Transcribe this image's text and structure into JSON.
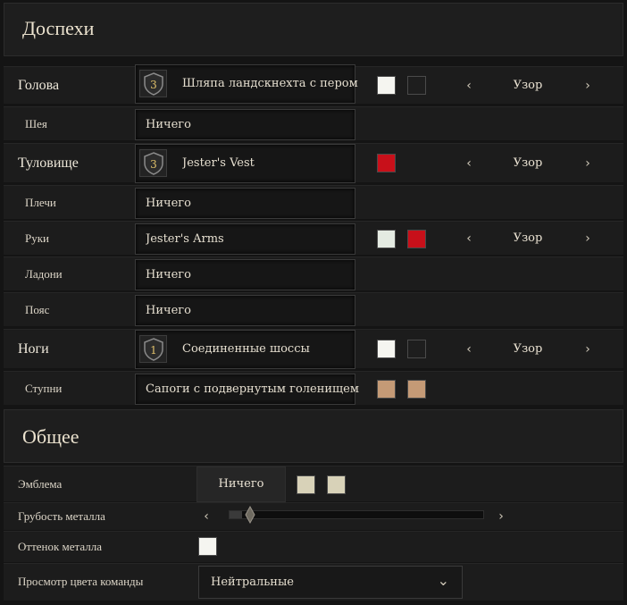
{
  "armor": {
    "title": "Доспехи",
    "rows": [
      {
        "label": "Голова",
        "item": "Шляпа ландскнехта с пером",
        "tier": "3",
        "pattern": "Узор",
        "colors": [
          "#f5f5f0",
          "#1e1e1e"
        ]
      },
      {
        "label": "Шея",
        "item": "Ничего"
      },
      {
        "label": "Туловище",
        "item": "Jester's Vest",
        "tier": "3",
        "pattern": "Узор",
        "colors": [
          "#c8101a"
        ]
      },
      {
        "label": "Плечи",
        "item": "Ничего"
      },
      {
        "label": "Руки",
        "item": "Jester's Arms",
        "pattern": "Узор",
        "colors": [
          "#e4ebe2",
          "#c8101a"
        ]
      },
      {
        "label": "Ладони",
        "item": "Ничего"
      },
      {
        "label": "Пояс",
        "item": "Ничего"
      },
      {
        "label": "Ноги",
        "item": "Соединенные шоссы",
        "tier": "1",
        "pattern": "Узор",
        "colors": [
          "#f5f5f0",
          "#1e1e1e"
        ]
      },
      {
        "label": "Ступни",
        "item": "Сапоги с подвернутым голенищем",
        "colors": [
          "#c49a76",
          "#c49a76"
        ]
      }
    ]
  },
  "general": {
    "title": "Общее",
    "emblem": {
      "label": "Эмблема",
      "value": "Ничего",
      "colors": [
        "#d8d2b8",
        "#d8d2b8"
      ]
    },
    "roughness": {
      "label": "Грубость металла",
      "level": 0.05
    },
    "tint": {
      "label": "Оттенок металла",
      "color": "#f5f5f0"
    },
    "team": {
      "label": "Просмотр цвета команды",
      "value": "Нейтральные"
    }
  },
  "icons": {
    "arrow_left": "‹",
    "arrow_right": "›",
    "dropdown": "⌄"
  }
}
